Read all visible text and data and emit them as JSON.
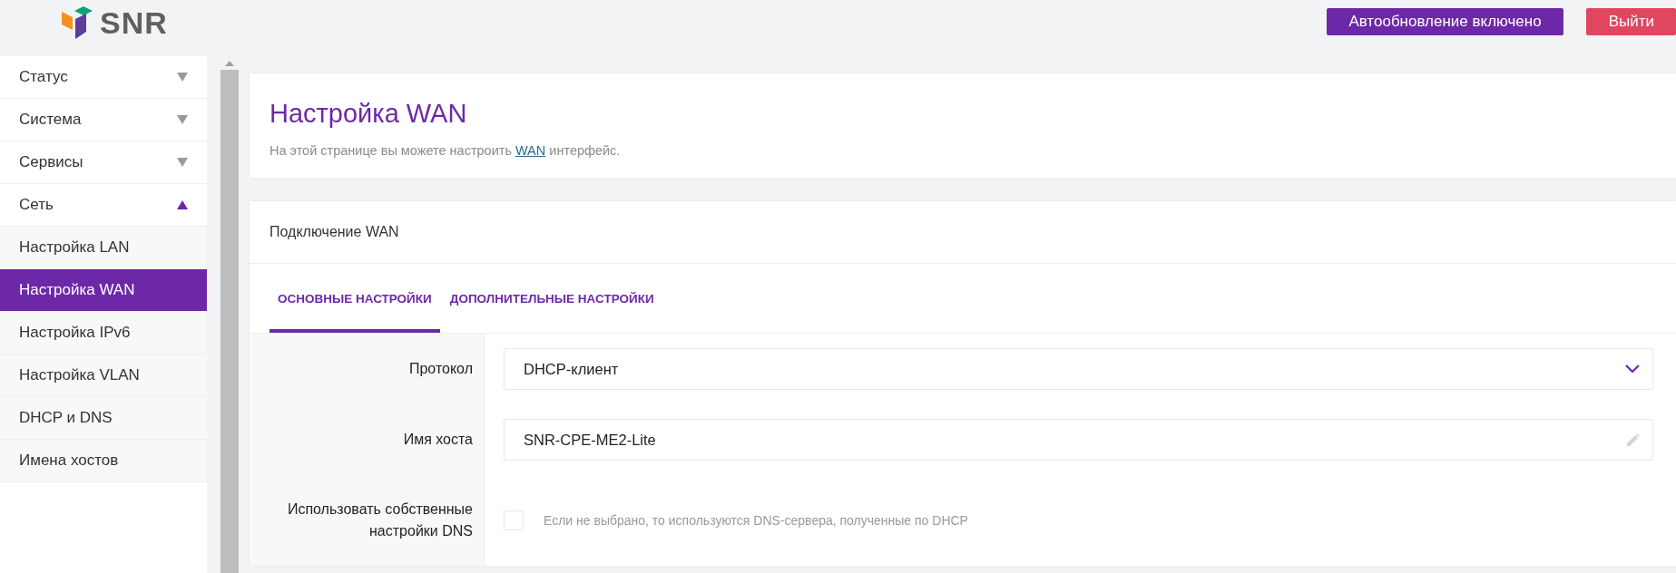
{
  "header": {
    "logo": "SNR",
    "buttons": [
      {
        "kind": "primary",
        "label": "Автообновление включено"
      },
      {
        "kind": "danger",
        "label": "Выйти"
      }
    ]
  },
  "sidebar": {
    "items": [
      {
        "label": "Статус",
        "expanded": false
      },
      {
        "label": "Система",
        "expanded": false
      },
      {
        "label": "Сервисы",
        "expanded": false
      },
      {
        "label": "Сеть",
        "expanded": true,
        "children": [
          {
            "label": "Настройка LAN",
            "selected": false
          },
          {
            "label": "Настройка WAN",
            "selected": true
          },
          {
            "label": "Настройка IPv6",
            "selected": false
          },
          {
            "label": "Настройка VLAN",
            "selected": false
          },
          {
            "label": "DHCP и DNS",
            "selected": false
          },
          {
            "label": "Имена хостов",
            "selected": false
          }
        ]
      }
    ]
  },
  "page": {
    "title": "Настройка WAN",
    "subtitle_before": "На этой странице вы можете настроить ",
    "subtitle_link": "WAN",
    "subtitle_after": " интерфейс."
  },
  "section": {
    "title": "Подключение WAN",
    "tabs": [
      {
        "label": "ОСНОВНЫЕ НАСТРОЙКИ",
        "selected": true
      },
      {
        "label": "ДОПОЛНИТЕЛЬНЫЕ НАСТРОЙКИ",
        "selected": false
      }
    ],
    "fields": [
      {
        "kind": "select",
        "label": "Протокол",
        "value": "DHCP-клиент"
      },
      {
        "kind": "text",
        "label": "Имя хоста",
        "value": "SNR-CPE-ME2-Lite"
      },
      {
        "kind": "checkbox",
        "label": "Использовать собственные настройки DNS",
        "checked": false,
        "hint": "Если не выбрано, то используются DNS-сервера, полученные по DHCP"
      }
    ]
  }
}
